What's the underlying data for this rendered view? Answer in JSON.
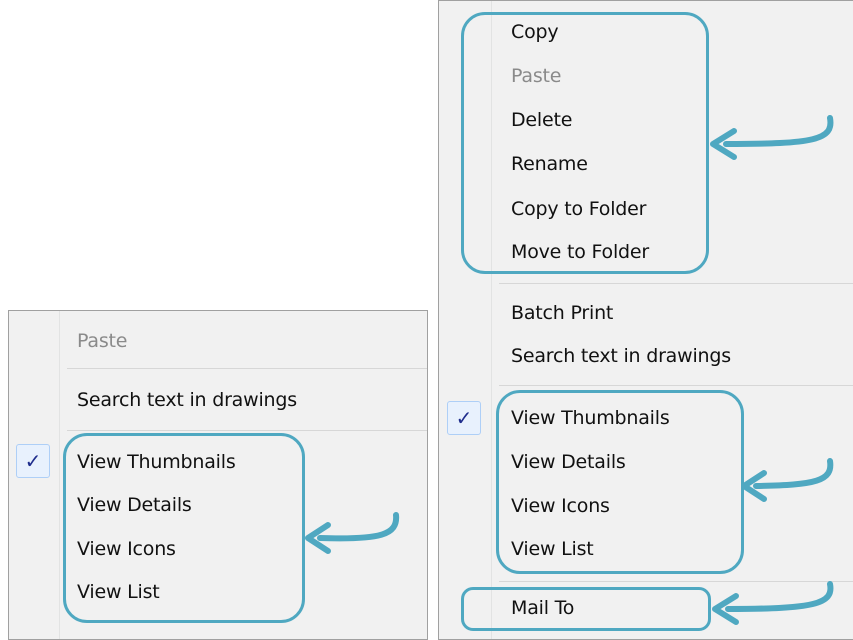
{
  "left_menu": {
    "items": [
      {
        "label": "Paste",
        "disabled": true
      },
      {
        "label": "Search text in drawings"
      },
      {
        "label": "View Thumbnails",
        "checked": true
      },
      {
        "label": "View Details"
      },
      {
        "label": "View Icons"
      },
      {
        "label": "View List"
      }
    ],
    "check_glyph": "✓"
  },
  "right_menu": {
    "items": [
      {
        "label": "Copy"
      },
      {
        "label": "Paste",
        "disabled": true
      },
      {
        "label": "Delete"
      },
      {
        "label": "Rename"
      },
      {
        "label": "Copy to Folder"
      },
      {
        "label": "Move to Folder"
      },
      {
        "label": "Batch Print"
      },
      {
        "label": "Search text in drawings"
      },
      {
        "label": "View Thumbnails",
        "checked": true
      },
      {
        "label": "View Details"
      },
      {
        "label": "View Icons"
      },
      {
        "label": "View List"
      },
      {
        "label": "Mail To"
      }
    ],
    "check_glyph": "✓"
  },
  "colors": {
    "callout": "#4fa8c1",
    "menu_background": "#f1f1f1",
    "check_mark": "#1f2d8c",
    "disabled_text": "#8a8a8a"
  }
}
